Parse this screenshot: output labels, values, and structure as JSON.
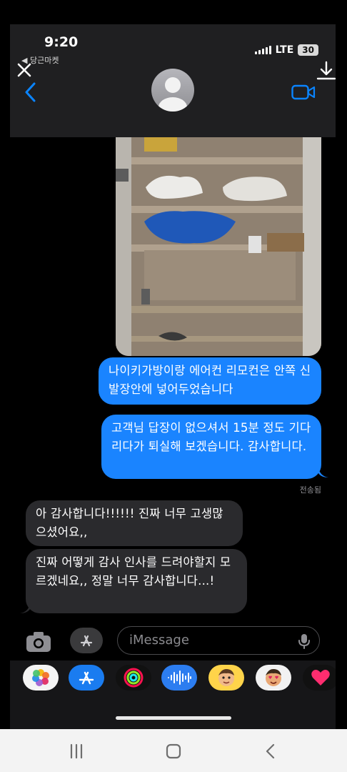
{
  "status_bar": {
    "time": "9:20",
    "back_app": "◀ 당근마켓",
    "network": "LTE",
    "battery": "30"
  },
  "composer": {
    "placeholder": "iMessage"
  },
  "messages": [
    {
      "direction": "outgoing",
      "text": "나이키가방이랑 에어컨 리모컨은 안쪽 신발장안에 넣어두었습니다"
    },
    {
      "direction": "outgoing",
      "text": "고객님 답장이 없으셔서 15분 정도 기다리다가 퇴실해 보겠습니다. 감사합니다."
    },
    {
      "direction": "incoming",
      "text": "아 감사합니다!!!!!! 진짜 너무 고생많으셨어요,,"
    },
    {
      "direction": "incoming",
      "text": "진짜 어떻게 감사 인사를 드려야할지 모르겠네요,, 정말 너무 감사합니다...!"
    }
  ],
  "delivered_label": "전송됨",
  "app_tray": [
    "photos-icon",
    "app-store-icon",
    "activity-icon",
    "audio-message-icon",
    "memoji-icon",
    "memoji-stickers-icon",
    "heart-sticker-icon"
  ],
  "colors": {
    "outgoing_bubble": "#1a84ff",
    "incoming_bubble": "#2a2a2d",
    "accent": "#0a84ff"
  }
}
